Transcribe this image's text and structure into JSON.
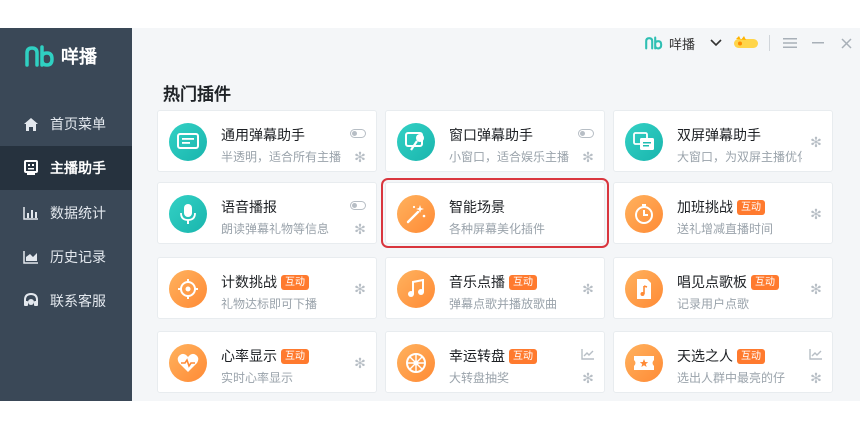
{
  "app": {
    "logo_text": "咩播"
  },
  "sidebar": {
    "items": [
      {
        "label": "首页菜单",
        "icon": "home-icon",
        "active": false
      },
      {
        "label": "主播助手",
        "icon": "assistant-icon",
        "active": true
      },
      {
        "label": "数据统计",
        "icon": "bar-chart-icon",
        "active": false
      },
      {
        "label": "历史记录",
        "icon": "history-icon",
        "active": false
      },
      {
        "label": "联系客服",
        "icon": "headset-icon",
        "active": false
      }
    ]
  },
  "titlebar": {
    "username": "咩播",
    "vip_icon": "vip-crown-icon",
    "menu_icon": "menu-icon",
    "minimize_icon": "minimize-icon",
    "close_icon": "close-icon"
  },
  "main": {
    "section_title": "热门插件",
    "plugins": [
      {
        "title": "通用弹幕助手",
        "desc": "半透明，适合所有主播",
        "icon": "chat-window-icon",
        "color": "teal",
        "tag": "",
        "toggle": true,
        "trend": false
      },
      {
        "title": "窗口弹幕助手",
        "desc": "小窗口，适合娱乐主播",
        "icon": "microphone-chat-icon",
        "color": "teal",
        "tag": "",
        "toggle": true,
        "trend": false
      },
      {
        "title": "双屏弹幕助手",
        "desc": "大窗口，为双屏主播优化",
        "icon": "dual-screen-icon",
        "color": "teal",
        "tag": "",
        "toggle": false,
        "trend": false
      },
      {
        "title": "语音播报",
        "desc": "朗读弹幕礼物等信息",
        "icon": "microphone-icon",
        "color": "teal",
        "tag": "",
        "toggle": true,
        "trend": false
      },
      {
        "title": "智能场景",
        "desc": "各种屏幕美化插件",
        "icon": "magic-wand-icon",
        "color": "orange",
        "tag": "",
        "toggle": false,
        "trend": false,
        "highlighted": true
      },
      {
        "title": "加班挑战",
        "desc": "送礼增减直播时间",
        "icon": "stopwatch-icon",
        "color": "orange",
        "tag": "互动",
        "toggle": false,
        "trend": false
      },
      {
        "title": "计数挑战",
        "desc": "礼物达标即可下播",
        "icon": "target-icon",
        "color": "orange",
        "tag": "互动",
        "toggle": false,
        "trend": false
      },
      {
        "title": "音乐点播",
        "desc": "弹幕点歌并播放歌曲",
        "icon": "music-note-icon",
        "color": "orange",
        "tag": "互动",
        "toggle": false,
        "trend": false
      },
      {
        "title": "唱见点歌板",
        "desc": "记录用户点歌",
        "icon": "song-list-icon",
        "color": "orange",
        "tag": "互动",
        "toggle": false,
        "trend": false
      },
      {
        "title": "心率显示",
        "desc": "实时心率显示",
        "icon": "heart-rate-icon",
        "color": "orange",
        "tag": "互动",
        "toggle": false,
        "trend": false
      },
      {
        "title": "幸运转盘",
        "desc": "大转盘抽奖",
        "icon": "wheel-icon",
        "color": "orange",
        "tag": "互动",
        "toggle": false,
        "trend": true
      },
      {
        "title": "天选之人",
        "desc": "选出人群中最亮的仔",
        "icon": "ticket-icon",
        "color": "orange",
        "tag": "互动",
        "toggle": false,
        "trend": true
      }
    ]
  }
}
